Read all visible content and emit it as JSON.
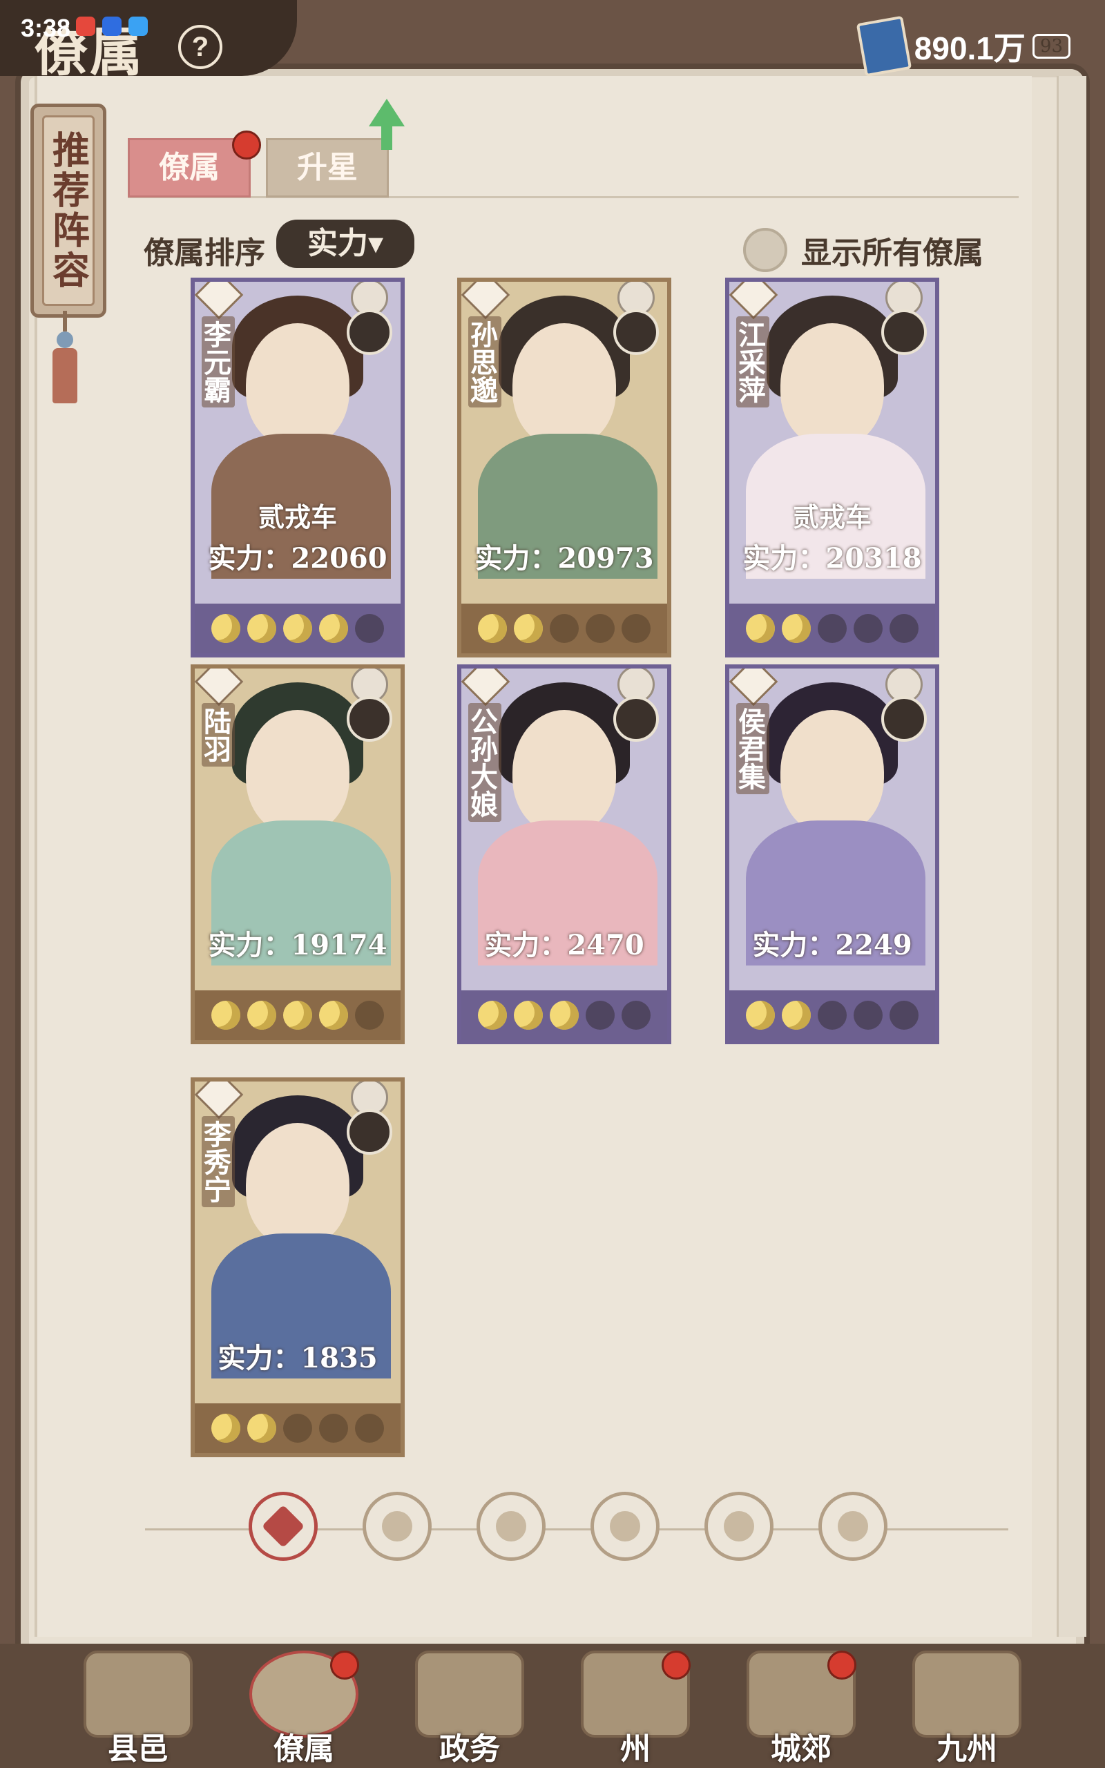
{
  "status_bar": {
    "time": "3:38",
    "battery": "93"
  },
  "header": {
    "title": "僚属",
    "help_icon": "?",
    "currency_value": "890.1万"
  },
  "side_scroll": {
    "label": "推荐阵容"
  },
  "tabs": [
    {
      "label": "僚属",
      "active": true,
      "has_dot": true
    },
    {
      "label": "升星",
      "active": false,
      "has_up_arrow": true
    }
  ],
  "sort": {
    "label": "僚属排序",
    "selected": "实力▾"
  },
  "show_all": {
    "label": "显示所有僚属"
  },
  "cards": [
    {
      "name": "李元霸",
      "level": "贰戎车",
      "power": "实力：22060",
      "stars_on": 4,
      "stars_total": 5,
      "theme": "purple"
    },
    {
      "name": "孙思邈",
      "level": "",
      "power": "实力：20973",
      "stars_on": 2,
      "stars_total": 5,
      "theme": "gold"
    },
    {
      "name": "江采萍",
      "level": "贰戎车",
      "power": "实力：20318",
      "stars_on": 2,
      "stars_total": 5,
      "theme": "purple"
    },
    {
      "name": "陆羽",
      "level": "",
      "power": "实力：19174",
      "stars_on": 4,
      "stars_total": 5,
      "theme": "gold"
    },
    {
      "name": "公孙大娘",
      "level": "",
      "power": "实力：2470",
      "stars_on": 3,
      "stars_total": 5,
      "theme": "purple"
    },
    {
      "name": "侯君集",
      "level": "",
      "power": "实力：2249",
      "stars_on": 2,
      "stars_total": 5,
      "theme": "purple"
    },
    {
      "name": "李秀宁",
      "level": "",
      "power": "实力：1835",
      "stars_on": 2,
      "stars_total": 5,
      "theme": "gold"
    }
  ],
  "filters": [
    {
      "icon": "all-icon",
      "active": true
    },
    {
      "icon": "helmet-icon",
      "active": false
    },
    {
      "icon": "gourd-icon",
      "active": false
    },
    {
      "icon": "fan-icon",
      "active": false
    },
    {
      "icon": "lion-icon",
      "active": false
    },
    {
      "icon": "leaf-icon",
      "active": false
    }
  ],
  "bottom_nav": [
    {
      "label": "县邑",
      "active": false,
      "has_dot": false
    },
    {
      "label": "僚属",
      "active": true,
      "has_dot": true
    },
    {
      "label": "政务",
      "active": false,
      "has_dot": false
    },
    {
      "label": "州",
      "active": false,
      "has_dot": true
    },
    {
      "label": "城郊",
      "active": false,
      "has_dot": true
    },
    {
      "label": "九州",
      "active": false,
      "has_dot": false
    }
  ],
  "colors": {
    "accent_red": "#b54a45",
    "moon_on": "#f3d977",
    "card_purple": "#c7c1d8",
    "card_gold": "#d9c7a1"
  }
}
